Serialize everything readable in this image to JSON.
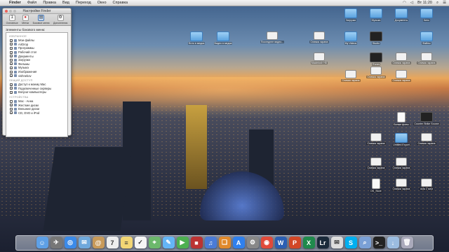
{
  "menubar": {
    "app_name": "Finder",
    "menus": [
      "Файл",
      "Правка",
      "Вид",
      "Переход",
      "Окно",
      "Справка"
    ],
    "clock": "Вт 11:20"
  },
  "prefs": {
    "title": "Настройки Finder",
    "tabs": [
      "Основные",
      "Метки",
      "Боковое меню",
      "Дополнения"
    ],
    "active_tab": 2,
    "heading": "Элементы бокового меню:",
    "groups": [
      {
        "title": "ИЗБРАННОЕ",
        "items": [
          {
            "label": "Мои файлы",
            "checked": true
          },
          {
            "label": "AirDrop",
            "checked": true
          },
          {
            "label": "Программы",
            "checked": true
          },
          {
            "label": "Рабочий стол",
            "checked": true
          },
          {
            "label": "Документы",
            "checked": true
          },
          {
            "label": "Загрузки",
            "checked": true
          },
          {
            "label": "Фильмы",
            "checked": true
          },
          {
            "label": "Музыка",
            "checked": true
          },
          {
            "label": "Изображения",
            "checked": true
          },
          {
            "label": "vishnekov",
            "checked": true
          }
        ]
      },
      {
        "title": "ОБЩИЙ ДОСТУП",
        "items": [
          {
            "label": "Доступ к моему Mac",
            "checked": true
          },
          {
            "label": "Подключенные серверы",
            "checked": true
          },
          {
            "label": "Bonjour-компьютеры",
            "checked": true
          }
        ]
      },
      {
        "title": "УСТРОЙСТВА",
        "items": [
          {
            "label": "Mac - Анна",
            "checked": false
          },
          {
            "label": "Жесткие диски",
            "checked": true
          },
          {
            "label": "Внешние диски",
            "checked": true
          },
          {
            "label": "CD, DVD и iPod",
            "checked": true
          }
        ]
      }
    ]
  },
  "desktop": {
    "icons": [
      {
        "label": "Фото в медиа",
        "kind": "folder"
      },
      {
        "label": "Видео в медиа",
        "kind": "folder"
      },
      {
        "label": "Последнее видео...",
        "kind": "shot"
      },
      {
        "label": "Снимок экрана",
        "kind": "shot"
      },
      {
        "label": "Macintosh HD",
        "kind": "shot"
      },
      {
        "label": "Загрузки",
        "kind": "folder"
      },
      {
        "label": "Музыка",
        "kind": "folder"
      },
      {
        "label": "Документы",
        "kind": "folder"
      },
      {
        "label": "Кино",
        "kind": "folder"
      },
      {
        "label": "My Videos",
        "kind": "folder"
      },
      {
        "label": "Файлы",
        "kind": "folder"
      },
      {
        "label": "Studio",
        "kind": "dark"
      },
      {
        "label": "iTunes",
        "kind": "dark"
      },
      {
        "label": "Снимок экрана",
        "kind": "shot"
      },
      {
        "label": "Снимок экрана",
        "kind": "shot"
      },
      {
        "label": "Снимок экрана",
        "kind": "shot"
      },
      {
        "label": "Снимок экрана",
        "kind": "shot"
      },
      {
        "label": "Снимок экрана",
        "kind": "shot"
      },
      {
        "label": "Белые фоны",
        "kind": "doc"
      },
      {
        "label": "Counter Strike Source",
        "kind": "dark"
      },
      {
        "label": "Снимок экрана",
        "kind": "shot"
      },
      {
        "label": "Untitled Export",
        "kind": "folder"
      },
      {
        "label": "Снимок экрана",
        "kind": "shot"
      },
      {
        "label": "Снимок экрана",
        "kind": "shot"
      },
      {
        "label": "Снимок экрана",
        "kind": "shot"
      },
      {
        "label": "DS_Store",
        "kind": "doc"
      },
      {
        "label": "Снимок экрана",
        "kind": "shot"
      },
      {
        "label": "dota 2 мем",
        "kind": "shot"
      }
    ]
  },
  "dock": {
    "apps": [
      {
        "name": "Finder",
        "color": "#5ea0e6",
        "glyph": "☺"
      },
      {
        "name": "Launchpad",
        "color": "#777",
        "glyph": "✈"
      },
      {
        "name": "Safari",
        "color": "#3b8ae8",
        "glyph": "◎"
      },
      {
        "name": "Mail",
        "color": "#6fa8dc",
        "glyph": "✉"
      },
      {
        "name": "Contacts",
        "color": "#c89a5a",
        "glyph": "@"
      },
      {
        "name": "Calendar",
        "color": "#eee",
        "glyph": "7"
      },
      {
        "name": "Notes",
        "color": "#f2d675",
        "glyph": "≡"
      },
      {
        "name": "Reminders",
        "color": "#f5f5f5",
        "glyph": "✓"
      },
      {
        "name": "Maps",
        "color": "#6cb86c",
        "glyph": "⌖"
      },
      {
        "name": "Messages",
        "color": "#64b5f6",
        "glyph": "✎"
      },
      {
        "name": "FaceTime",
        "color": "#4caf50",
        "glyph": "▶"
      },
      {
        "name": "Photo Booth",
        "color": "#b33",
        "glyph": "■"
      },
      {
        "name": "iTunes",
        "color": "#4a7bd6",
        "glyph": "♫"
      },
      {
        "name": "iBooks",
        "color": "#e08a2c",
        "glyph": "❏"
      },
      {
        "name": "App Store",
        "color": "#2f80ed",
        "glyph": "A"
      },
      {
        "name": "System Preferences",
        "color": "#888",
        "glyph": "⚙"
      },
      {
        "name": "Chrome",
        "color": "#e04a3a",
        "glyph": "◉"
      },
      {
        "name": "Word",
        "color": "#2b5fb3",
        "glyph": "W"
      },
      {
        "name": "PowerPoint",
        "color": "#d24726",
        "glyph": "P"
      },
      {
        "name": "Excel",
        "color": "#1f8a4c",
        "glyph": "X"
      },
      {
        "name": "Lightroom",
        "color": "#1a2a3a",
        "glyph": "Lr"
      },
      {
        "name": "Mail Drop",
        "color": "#ddd",
        "glyph": "✉"
      },
      {
        "name": "Skype",
        "color": "#00aff0",
        "glyph": "S"
      },
      {
        "name": "Preview",
        "color": "#7aa0d6",
        "glyph": "⌕"
      },
      {
        "name": "Terminal",
        "color": "#222",
        "glyph": ">_"
      },
      {
        "name": "Downloads",
        "color": "#9bbce0",
        "glyph": "↓"
      },
      {
        "name": "Trash",
        "color": "#aab",
        "glyph": "🗑"
      }
    ]
  }
}
